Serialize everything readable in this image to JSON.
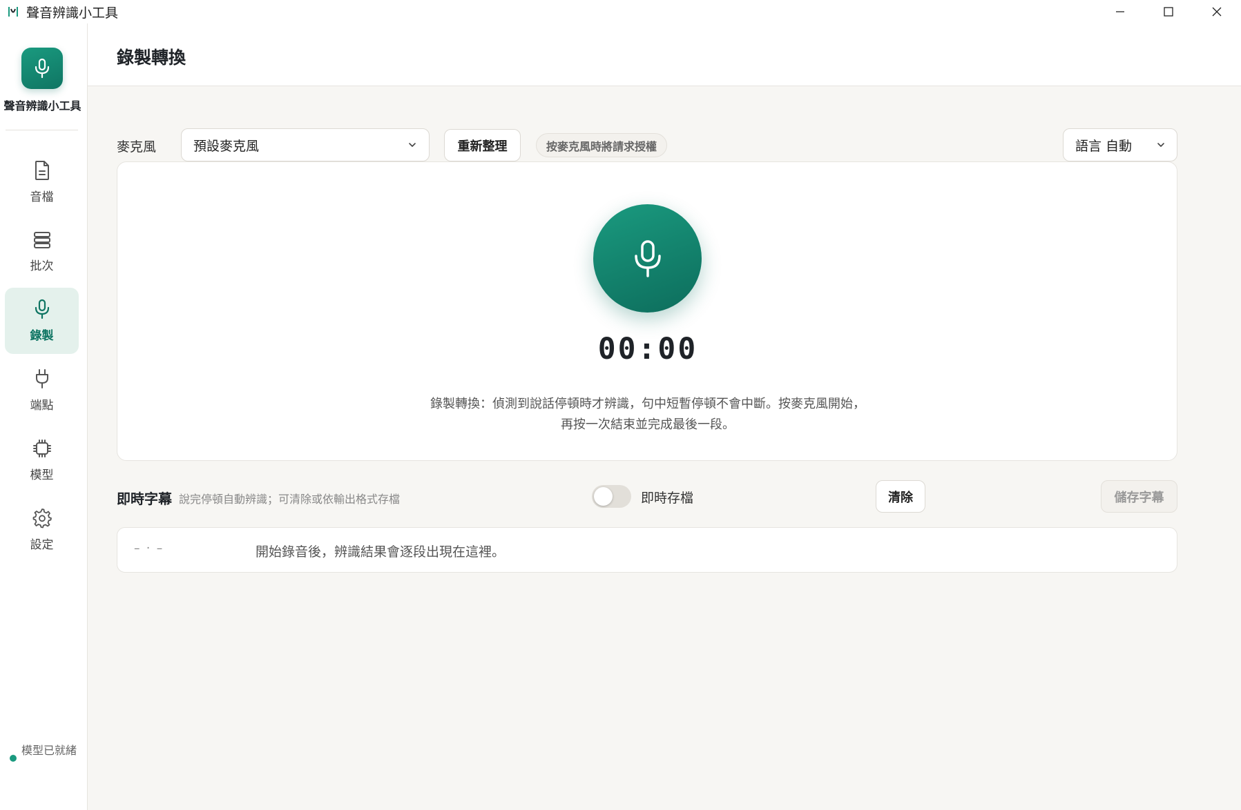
{
  "window": {
    "title": "聲音辨識小工具",
    "icons": {
      "app": "app-icon",
      "minimize": "minimize-icon",
      "maximize": "maximize-icon",
      "close": "close-icon"
    }
  },
  "sidebar": {
    "brand_name": "聲音辨識小工具",
    "brand_icon": "microphone-icon",
    "items": [
      {
        "label": "音檔",
        "icon": "document-icon",
        "active": false
      },
      {
        "label": "批次",
        "icon": "stack-icon",
        "active": false
      },
      {
        "label": "錄製",
        "icon": "microphone-icon",
        "active": true
      },
      {
        "label": "端點",
        "icon": "plug-icon",
        "active": false
      },
      {
        "label": "模型",
        "icon": "chip-icon",
        "active": false
      },
      {
        "label": "設定",
        "icon": "gear-icon",
        "active": false
      }
    ],
    "status": "模型已就緒"
  },
  "header": {
    "title": "錄製轉換"
  },
  "mic_row": {
    "label": "麥克風",
    "device_selected": "預設麥克風",
    "refresh_label": "重新整理",
    "permission_hint": "按麥克風時將請求授權",
    "language_selected": "語言 自動"
  },
  "recorder": {
    "timer": "00:00",
    "description": "錄製轉換：偵測到說話停頓時才辨識，句中短暫停頓不會中斷。按麥克風開始，再按一次結束並完成最後一段。"
  },
  "subtitles": {
    "title": "即時字幕",
    "hint": "說完停頓自動辨識；可清除或依輸出格式存檔",
    "autosave_label": "即時存檔",
    "autosave_on": false,
    "clear_label": "清除",
    "save_label": "儲存字幕",
    "placeholder_timecode": "– · –",
    "placeholder_text": "開始錄音後，辨識結果會逐段出現在這裡。"
  },
  "colors": {
    "accent": "#0f7563",
    "accent_light": "#1a9a7f",
    "active_bg": "#e4f1ec",
    "page_bg": "#f7f6f3"
  }
}
